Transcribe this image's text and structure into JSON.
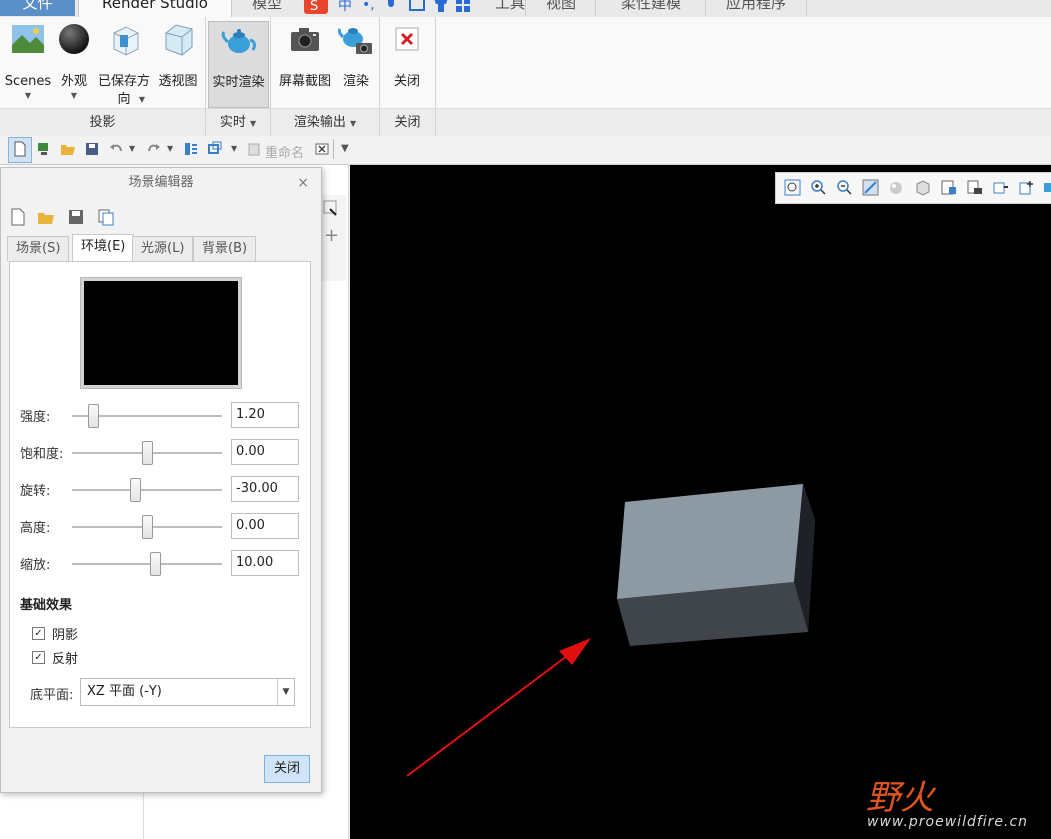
{
  "tabs": {
    "file": "文件",
    "render_studio": "Render Studio",
    "model": "模型",
    "tools": "工具",
    "view": "视图",
    "flex": "柔性建模",
    "apps": "应用程序"
  },
  "ribbon": {
    "buttons": {
      "scenes": "Scenes",
      "appearance": "外观",
      "saved_orient": "已保存方向",
      "perspective": "透视图",
      "realtime": "实时渲染",
      "screenshot": "屏幕截图",
      "render": "渲染",
      "close": "关闭"
    },
    "groups": {
      "projection": "投影",
      "realtime": "实时",
      "render_output": "渲染输出",
      "close": "关闭"
    }
  },
  "qat": {
    "rename": "重命名"
  },
  "dialog": {
    "title": "场景编辑器",
    "tabs": [
      "场景(S)",
      "环境(E)",
      "光源(L)",
      "背景(B)"
    ],
    "active_tab": 1,
    "sliders": [
      {
        "label": "强度:",
        "value": "1.20",
        "level": 0.14
      },
      {
        "label": "饱和度:",
        "value": "0.00",
        "level": 0.5
      },
      {
        "label": "旋转:",
        "value": "-30.00",
        "level": 0.42
      },
      {
        "label": "高度:",
        "value": "0.00",
        "level": 0.5
      },
      {
        "label": "缩放:",
        "value": "10.00",
        "level": 0.55
      }
    ],
    "basic_effects_title": "基础效果",
    "checkboxes": [
      {
        "label": "阴影",
        "checked": true
      },
      {
        "label": "反射",
        "checked": true
      }
    ],
    "floor_label": "底平面:",
    "floor_value": "XZ 平面 (-Y)",
    "close_button": "关闭"
  },
  "watermark": {
    "logo": "野火",
    "url": "www.proewildfire.cn"
  },
  "colors": {
    "accent": "#5b8fc8",
    "viewport_bg": "#000000",
    "annotation_arrow": "#e01010"
  }
}
